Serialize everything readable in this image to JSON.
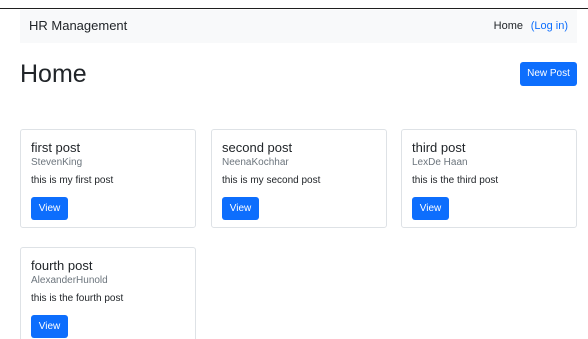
{
  "navbar": {
    "brand": "HR Management",
    "home_label": "Home",
    "login_label": "(Log in)"
  },
  "page": {
    "title": "Home",
    "new_post_label": "New Post"
  },
  "posts": [
    {
      "title": "first post",
      "author": "StevenKing",
      "body": "this is my first post",
      "view_label": "View"
    },
    {
      "title": "second post",
      "author": "NeenaKochhar",
      "body": "this is my second post",
      "view_label": "View"
    },
    {
      "title": "third post",
      "author": "LexDe Haan",
      "body": "this is the third post",
      "view_label": "View"
    },
    {
      "title": "fourth post",
      "author": "AlexanderHunold",
      "body": "this is the fourth post",
      "view_label": "View"
    }
  ],
  "colors": {
    "primary": "#0d6efd",
    "navbar_bg": "#f8f9fa",
    "muted_text": "#6c757d",
    "card_border": "#dee2e6"
  }
}
